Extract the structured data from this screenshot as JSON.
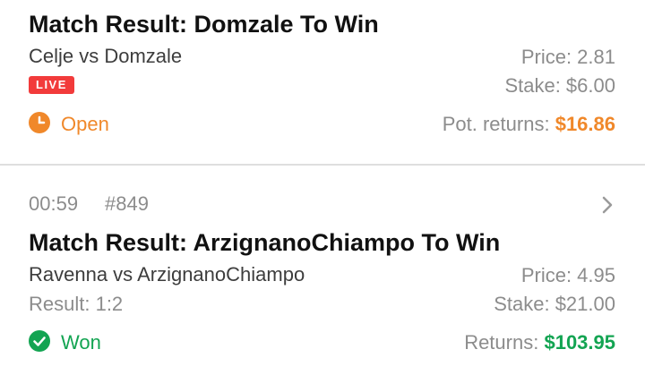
{
  "bet1": {
    "title": "Match Result: Domzale To Win",
    "match": "Celje vs Domzale",
    "badge": "LIVE",
    "price_label": "Price: 2.81",
    "stake_label": "Stake: $6.00",
    "status": "Open",
    "returns_label": "Pot. returns:",
    "returns_value": "$16.86"
  },
  "bet2": {
    "time": "00:59",
    "ref": "#849",
    "title": "Match Result: ArzignanoChiampo To Win",
    "match": "Ravenna vs ArzignanoChiampo",
    "result": "Result: 1:2",
    "price_label": "Price: 4.95",
    "stake_label": "Stake: $21.00",
    "status": "Won",
    "returns_label": "Returns:",
    "returns_value": "$103.95"
  },
  "colors": {
    "open": "#f0882a",
    "won": "#13a452",
    "live": "#f23b3b"
  },
  "icons": {
    "open": "clock-icon",
    "won": "check-circle-icon",
    "details": "chevron-right-icon"
  }
}
